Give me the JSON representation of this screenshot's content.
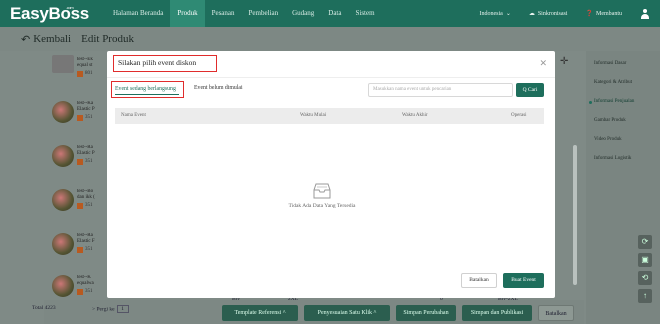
{
  "app": {
    "logo": "EasyBoss",
    "logo_sup": ".com"
  },
  "nav": {
    "items": [
      "Halaman Beranda",
      "Produk",
      "Pesanan",
      "Pembelian",
      "Gudang",
      "Data",
      "Sistem"
    ],
    "active_index": 1,
    "language": "Indonesia",
    "sync": "Sinkronisasi",
    "help": "Membantu"
  },
  "page": {
    "back_label": "Kembali",
    "title": "Edit Produk"
  },
  "products": [
    {
      "name": "test--Ek",
      "name2": "equal st",
      "code": "801"
    },
    {
      "name": "test--Ka",
      "name2": "Elastic P",
      "code": "351"
    },
    {
      "name": "test--Ra",
      "name2": "Elastic P",
      "code": "351"
    },
    {
      "name": "test--Bo",
      "name2": "dan ikk (",
      "code": "351"
    },
    {
      "name": "test--Ra",
      "name2": "Elastic F",
      "code": "351"
    },
    {
      "name": "test--K",
      "name2": "equalwa",
      "code": "351"
    }
  ],
  "pagination": {
    "total": "Total 4223",
    "page_label": "> Pergi ke",
    "page": "1"
  },
  "bottom_sizes": [
    "Biv",
    "2XL",
    "0",
    "Biv-2XL"
  ],
  "bottom_buttons": {
    "template": "Template Referensi ^",
    "bulk": "Penyesuaian Satu Klik ^",
    "save": "Simpan Perubahan",
    "save_publish": "Simpan dan Publikasi",
    "cancel": "Batalkan"
  },
  "right_panel": {
    "items": [
      "Informasi Dasar",
      "Kategori & Atribut",
      "Informasi Penjualan",
      "Gambar Produk",
      "Video Produk",
      "Informasi Logistik"
    ],
    "active_index": 2
  },
  "side_buttons": [
    "⟳",
    "▣",
    "⟲",
    "↑"
  ],
  "modal": {
    "title": "Silakan pilih event diskon",
    "tabs": [
      "Event sedang berlangsung",
      "Event belum dimulai"
    ],
    "active_tab": 0,
    "search_placeholder": "Masukkan nama event untuk pencarian",
    "search_button": "Q Cari",
    "columns": [
      "Nama Event",
      "Waktu Mulai",
      "Waktu Akhir",
      "Operasi"
    ],
    "empty_text": "Tidak Ada Data Yang Tersedia",
    "cancel": "Batalkan",
    "create": "Buat Event"
  },
  "colors": {
    "brand": "#1e6e5c",
    "highlight": "#e02c2c"
  }
}
